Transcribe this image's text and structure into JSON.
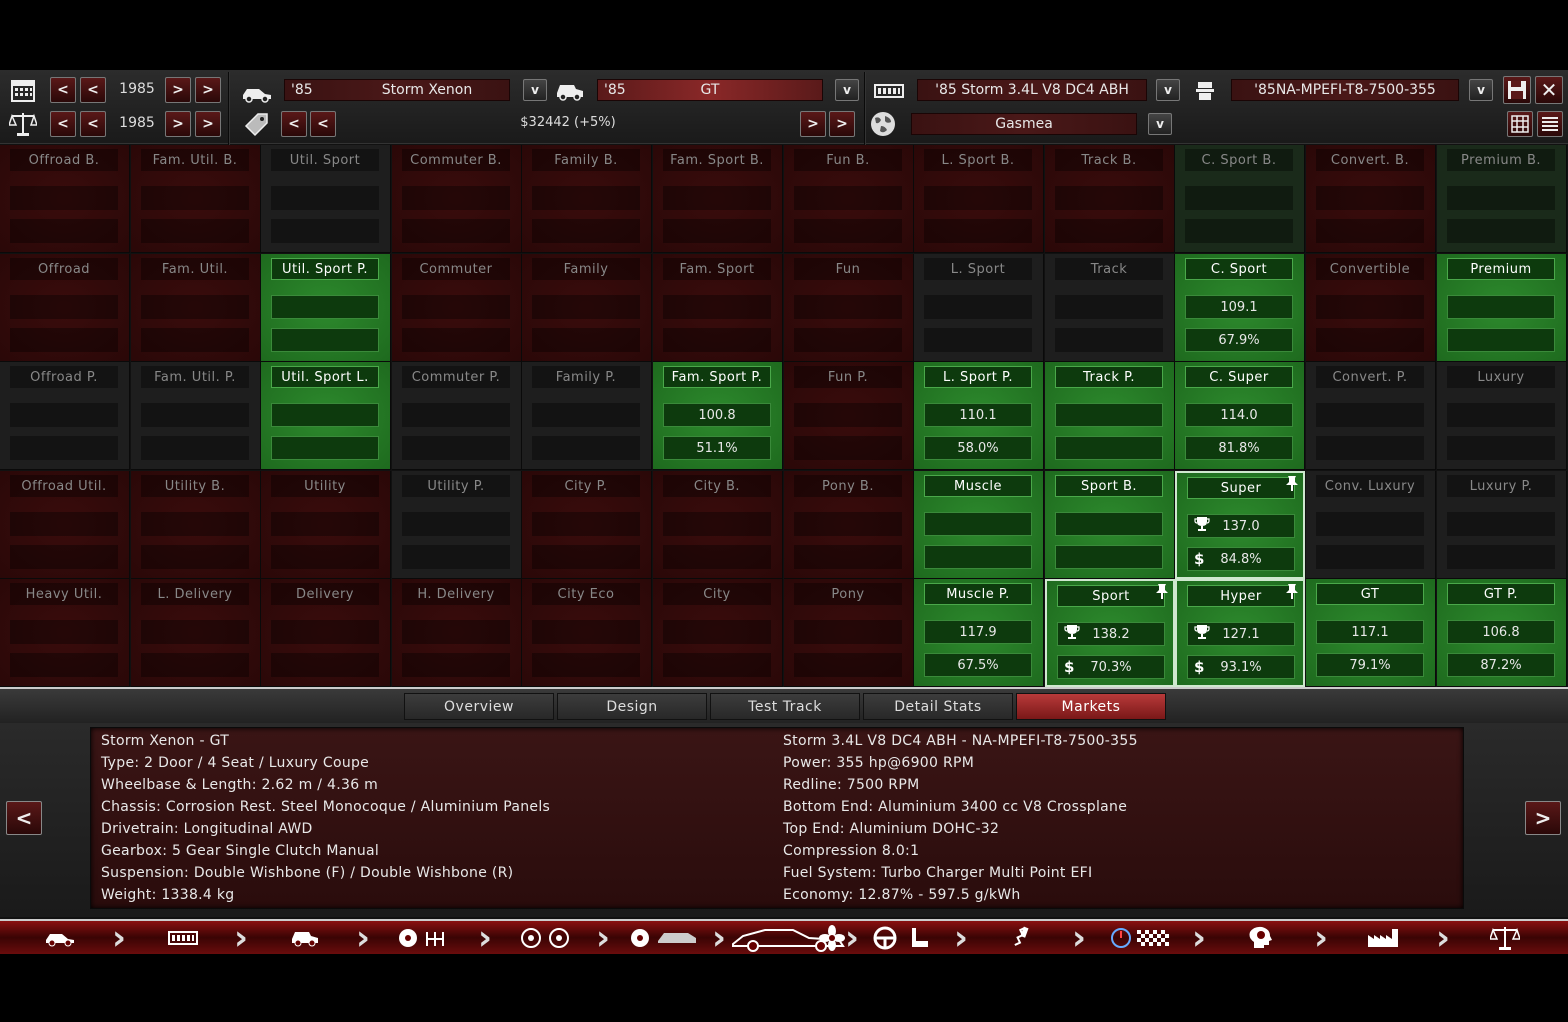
{
  "toolbar": {
    "row1": {
      "year": "1985",
      "model_prefix": "'85",
      "model_name": "Storm Xenon",
      "trim_prefix": "'85",
      "trim_name": "GT",
      "engine_name": "'85 Storm 3.4L V8 DC4 ABH",
      "engine_variant": "'85NA-MPEFI-T8-7500-355"
    },
    "row2": {
      "year": "1985",
      "price": "$32442 (+5%)",
      "market": "Gasmea"
    },
    "dropdown_symbol": "v",
    "left_symbol": "<",
    "right_symbol": ">"
  },
  "grid": {
    "cells": [
      {
        "name": "Offroad B.",
        "v1": "",
        "v2": "",
        "style": "red"
      },
      {
        "name": "Fam. Util. B.",
        "v1": "",
        "v2": "",
        "style": "red"
      },
      {
        "name": "Util. Sport",
        "v1": "",
        "v2": "",
        "style": "grey"
      },
      {
        "name": "Commuter B.",
        "v1": "",
        "v2": "",
        "style": "red"
      },
      {
        "name": "Family B.",
        "v1": "",
        "v2": "",
        "style": "red"
      },
      {
        "name": "Fam. Sport B.",
        "v1": "",
        "v2": "",
        "style": "red"
      },
      {
        "name": "Fun B.",
        "v1": "",
        "v2": "",
        "style": "red"
      },
      {
        "name": "L. Sport B.",
        "v1": "",
        "v2": "",
        "style": "red"
      },
      {
        "name": "Track B.",
        "v1": "",
        "v2": "",
        "style": "red"
      },
      {
        "name": "C. Sport B.",
        "v1": "",
        "v2": "",
        "style": "dgreen"
      },
      {
        "name": "Convert. B.",
        "v1": "",
        "v2": "",
        "style": "red"
      },
      {
        "name": "Premium B.",
        "v1": "",
        "v2": "",
        "style": "dgreen"
      },
      {
        "name": "Offroad",
        "v1": "",
        "v2": "",
        "style": "red"
      },
      {
        "name": "Fam. Util.",
        "v1": "",
        "v2": "",
        "style": "red"
      },
      {
        "name": "Util. Sport P.",
        "v1": "",
        "v2": "",
        "style": "green"
      },
      {
        "name": "Commuter",
        "v1": "",
        "v2": "",
        "style": "red"
      },
      {
        "name": "Family",
        "v1": "",
        "v2": "",
        "style": "red"
      },
      {
        "name": "Fam. Sport",
        "v1": "",
        "v2": "",
        "style": "red"
      },
      {
        "name": "Fun",
        "v1": "",
        "v2": "",
        "style": "red"
      },
      {
        "name": "L. Sport",
        "v1": "",
        "v2": "",
        "style": "grey"
      },
      {
        "name": "Track",
        "v1": "",
        "v2": "",
        "style": "grey"
      },
      {
        "name": "C. Sport",
        "v1": "109.1",
        "v2": "67.9%",
        "style": "green"
      },
      {
        "name": "Convertible",
        "v1": "",
        "v2": "",
        "style": "red"
      },
      {
        "name": "Premium",
        "v1": "",
        "v2": "",
        "style": "green"
      },
      {
        "name": "Offroad P.",
        "v1": "",
        "v2": "",
        "style": "grey"
      },
      {
        "name": "Fam. Util. P.",
        "v1": "",
        "v2": "",
        "style": "grey"
      },
      {
        "name": "Util. Sport L.",
        "v1": "",
        "v2": "",
        "style": "green"
      },
      {
        "name": "Commuter P.",
        "v1": "",
        "v2": "",
        "style": "grey"
      },
      {
        "name": "Family P.",
        "v1": "",
        "v2": "",
        "style": "grey"
      },
      {
        "name": "Fam. Sport P.",
        "v1": "100.8",
        "v2": "51.1%",
        "style": "green"
      },
      {
        "name": "Fun P.",
        "v1": "",
        "v2": "",
        "style": "red"
      },
      {
        "name": "L. Sport P.",
        "v1": "110.1",
        "v2": "58.0%",
        "style": "green"
      },
      {
        "name": "Track P.",
        "v1": "",
        "v2": "",
        "style": "green"
      },
      {
        "name": "C. Super",
        "v1": "114.0",
        "v2": "81.8%",
        "style": "green"
      },
      {
        "name": "Convert. P.",
        "v1": "",
        "v2": "",
        "style": "grey"
      },
      {
        "name": "Luxury",
        "v1": "",
        "v2": "",
        "style": "grey"
      },
      {
        "name": "Offroad Util.",
        "v1": "",
        "v2": "",
        "style": "red"
      },
      {
        "name": "Utility B.",
        "v1": "",
        "v2": "",
        "style": "red"
      },
      {
        "name": "Utility",
        "v1": "",
        "v2": "",
        "style": "red"
      },
      {
        "name": "Utility P.",
        "v1": "",
        "v2": "",
        "style": "grey"
      },
      {
        "name": "City P.",
        "v1": "",
        "v2": "",
        "style": "red"
      },
      {
        "name": "City B.",
        "v1": "",
        "v2": "",
        "style": "red"
      },
      {
        "name": "Pony B.",
        "v1": "",
        "v2": "",
        "style": "red"
      },
      {
        "name": "Muscle",
        "v1": "",
        "v2": "",
        "style": "green"
      },
      {
        "name": "Sport B.",
        "v1": "",
        "v2": "",
        "style": "green"
      },
      {
        "name": "Super",
        "v1": "137.0",
        "v2": "84.8%",
        "style": "green",
        "best": true
      },
      {
        "name": "Conv. Luxury",
        "v1": "",
        "v2": "",
        "style": "grey"
      },
      {
        "name": "Luxury P.",
        "v1": "",
        "v2": "",
        "style": "grey"
      },
      {
        "name": "Heavy Util.",
        "v1": "",
        "v2": "",
        "style": "red"
      },
      {
        "name": "L. Delivery",
        "v1": "",
        "v2": "",
        "style": "red"
      },
      {
        "name": "Delivery",
        "v1": "",
        "v2": "",
        "style": "red"
      },
      {
        "name": "H. Delivery",
        "v1": "",
        "v2": "",
        "style": "red"
      },
      {
        "name": "City Eco",
        "v1": "",
        "v2": "",
        "style": "red"
      },
      {
        "name": "City",
        "v1": "",
        "v2": "",
        "style": "red"
      },
      {
        "name": "Pony",
        "v1": "",
        "v2": "",
        "style": "red"
      },
      {
        "name": "Muscle P.",
        "v1": "117.9",
        "v2": "67.5%",
        "style": "green"
      },
      {
        "name": "Sport",
        "v1": "138.2",
        "v2": "70.3%",
        "style": "green",
        "best": true
      },
      {
        "name": "Hyper",
        "v1": "127.1",
        "v2": "93.1%",
        "style": "green",
        "best": true
      },
      {
        "name": "GT",
        "v1": "117.1",
        "v2": "79.1%",
        "style": "green"
      },
      {
        "name": "GT P.",
        "v1": "106.8",
        "v2": "87.2%",
        "style": "green"
      }
    ]
  },
  "tabs": [
    {
      "label": "Overview",
      "active": false
    },
    {
      "label": "Design",
      "active": false
    },
    {
      "label": "Test Track",
      "active": false
    },
    {
      "label": "Detail Stats",
      "active": false
    },
    {
      "label": "Markets",
      "active": true
    }
  ],
  "details": {
    "left": [
      "Storm Xenon - GT",
      "Type: 2 Door / 4 Seat / Luxury Coupe",
      "Wheelbase & Length: 2.62 m / 4.36 m",
      "Chassis: Corrosion Rest. Steel Monocoque / Aluminium Panels",
      "Drivetrain: Longitudinal AWD",
      "Gearbox: 5 Gear Single Clutch Manual",
      "Suspension: Double Wishbone (F) / Double Wishbone (R)",
      "Weight: 1338.4 kg"
    ],
    "right": [
      "Storm 3.4L V8 DC4 ABH - NA-MPEFI-T8-7500-355",
      "Power: 355 hp@6900 RPM",
      "Redline: 7500 RPM",
      "Bottom End: Aluminium 3400 cc V8 Crossplane",
      "Top End: Aluminium DOHC-32",
      "Compression 8.0:1",
      "Fuel System: Turbo Charger Multi Point EFI",
      "Economy: 12.87% - 597.5 g/kWh"
    ]
  },
  "icons": {
    "calendar": "calendar-icon",
    "scale": "scale-icon",
    "car": "car-icon",
    "trophy": "trophy-icon",
    "dollar": "dollar-icon",
    "pin": "pin-icon"
  },
  "colors": {
    "accent_red": "#8a1010",
    "accent_green": "#2d8a2d"
  }
}
